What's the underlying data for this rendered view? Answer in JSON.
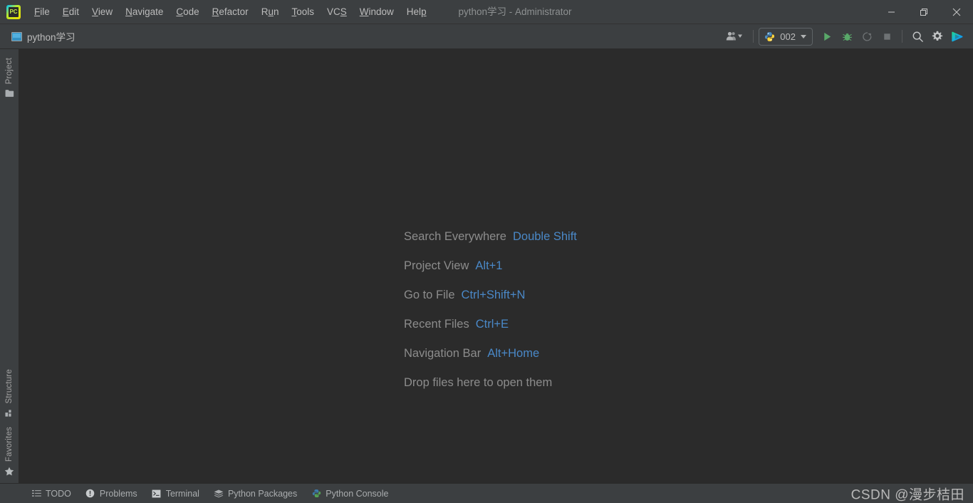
{
  "window": {
    "title": "python学习 - Administrator",
    "logo_text": "PC",
    "logo_name": "pycharm-logo-icon",
    "controls": {
      "minimize": "minimize-icon",
      "restore": "restore-icon",
      "close": "close-icon"
    }
  },
  "menu": {
    "items": [
      {
        "label": "File",
        "mnemonic": "F",
        "rest": "ile"
      },
      {
        "label": "Edit",
        "mnemonic": "E",
        "rest": "dit"
      },
      {
        "label": "View",
        "mnemonic": "V",
        "rest": "iew"
      },
      {
        "label": "Navigate",
        "mnemonic": "N",
        "rest": "avigate"
      },
      {
        "label": "Code",
        "mnemonic": "C",
        "rest": "ode"
      },
      {
        "label": "Refactor",
        "mnemonic": "R",
        "rest": "efactor"
      },
      {
        "label": "Run",
        "mnemonic": "R",
        "rest": "un"
      },
      {
        "label": "Tools",
        "mnemonic": "T",
        "rest": "ools"
      },
      {
        "label": "VCS",
        "mnemonic": "",
        "rest": "VCS"
      },
      {
        "label": "Window",
        "mnemonic": "W",
        "rest": "indow"
      },
      {
        "label": "Help",
        "mnemonic": "H",
        "rest": "elp"
      }
    ]
  },
  "navbar": {
    "breadcrumb": "python学习",
    "breadcrumb_icon": "project-folder-icon"
  },
  "toolbar": {
    "users_icon": "users-icon",
    "users_caret": "chevron-down-icon",
    "run_config": {
      "name": "002",
      "icon": "python-file-icon",
      "caret": "chevron-down-icon"
    },
    "buttons": [
      {
        "name": "run-button",
        "title": "Run",
        "icon": "play-icon",
        "enabled": true
      },
      {
        "name": "debug-button",
        "title": "Debug",
        "icon": "bug-icon",
        "enabled": true
      },
      {
        "name": "coverage-button",
        "title": "Run with Coverage",
        "icon": "coverage-icon",
        "enabled": false
      },
      {
        "name": "stop-button",
        "title": "Stop",
        "icon": "stop-icon",
        "enabled": false
      },
      {
        "name": "search-button",
        "title": "Search Everywhere",
        "icon": "search-icon",
        "enabled": true
      },
      {
        "name": "settings-button",
        "title": "Settings",
        "icon": "gear-icon",
        "enabled": true
      },
      {
        "name": "updates-button",
        "title": "Toolbox",
        "icon": "gradient-play-icon",
        "enabled": true
      }
    ]
  },
  "left_stripe": {
    "top": [
      {
        "label": "Project",
        "icon": "project-folder-icon",
        "name": "tool-window-project"
      }
    ],
    "bottom": [
      {
        "label": "Structure",
        "icon": "structure-icon",
        "name": "tool-window-structure"
      },
      {
        "label": "Favorites",
        "icon": "star-icon",
        "name": "tool-window-favorites"
      }
    ]
  },
  "editor": {
    "hints": [
      {
        "action": "Search Everywhere",
        "shortcut": "Double Shift"
      },
      {
        "action": "Project View",
        "shortcut": "Alt+1"
      },
      {
        "action": "Go to File",
        "shortcut": "Ctrl+Shift+N"
      },
      {
        "action": "Recent Files",
        "shortcut": "Ctrl+E"
      },
      {
        "action": "Navigation Bar",
        "shortcut": "Alt+Home"
      }
    ],
    "drop_hint": "Drop files here to open them"
  },
  "statusbar": {
    "tools": [
      {
        "label": "TODO",
        "icon": "todo-list-icon",
        "name": "tool-window-todo"
      },
      {
        "label": "Problems",
        "icon": "problems-icon",
        "name": "tool-window-problems"
      },
      {
        "label": "Terminal",
        "icon": "terminal-icon",
        "name": "tool-window-terminal"
      },
      {
        "label": "Python Packages",
        "icon": "packages-icon",
        "name": "tool-window-python-packages"
      },
      {
        "label": "Python Console",
        "icon": "python-console-icon",
        "name": "tool-window-python-console"
      }
    ],
    "watermark": "CSDN @漫步桔田"
  },
  "colors": {
    "chrome": "#3c3f41",
    "editor_bg": "#2b2b2b",
    "text": "#bbbbbb",
    "muted_text": "#8c8c8c",
    "shortcut_blue": "#4a88c7",
    "run_green": "#59a869"
  }
}
